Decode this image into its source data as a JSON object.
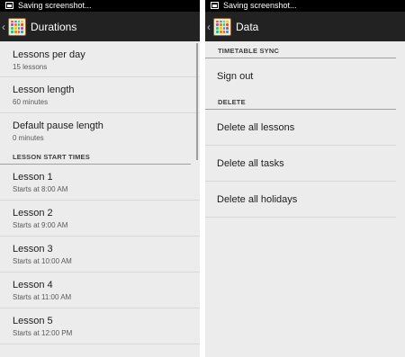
{
  "status": {
    "text": "Saving screenshot..."
  },
  "left": {
    "title": "Durations",
    "items": [
      {
        "title": "Lessons per day",
        "summary": "15 lessons"
      },
      {
        "title": "Lesson length",
        "summary": "60 minutes"
      },
      {
        "title": "Default pause length",
        "summary": "0 minutes"
      }
    ],
    "category": "LESSON START TIMES",
    "lessons": [
      {
        "title": "Lesson 1",
        "summary": "Starts at 8:00 AM"
      },
      {
        "title": "Lesson 2",
        "summary": "Starts at 9:00 AM"
      },
      {
        "title": "Lesson 3",
        "summary": "Starts at 10:00 AM"
      },
      {
        "title": "Lesson 4",
        "summary": "Starts at 11:00 AM"
      },
      {
        "title": "Lesson 5",
        "summary": "Starts at 12:00 PM"
      }
    ]
  },
  "right": {
    "title": "Data",
    "sync_category": "TIMETABLE SYNC",
    "sign_out": "Sign out",
    "delete_category": "DELETE",
    "delete_items": [
      "Delete all lessons",
      "Delete all tasks",
      "Delete all holidays"
    ]
  },
  "colors": {
    "actionbar": "#222222",
    "background": "#ececec",
    "statusbar": "#000000"
  },
  "icons": {
    "status": "image-icon",
    "back": "chevron-left-icon",
    "app": "timetable-app-icon"
  }
}
